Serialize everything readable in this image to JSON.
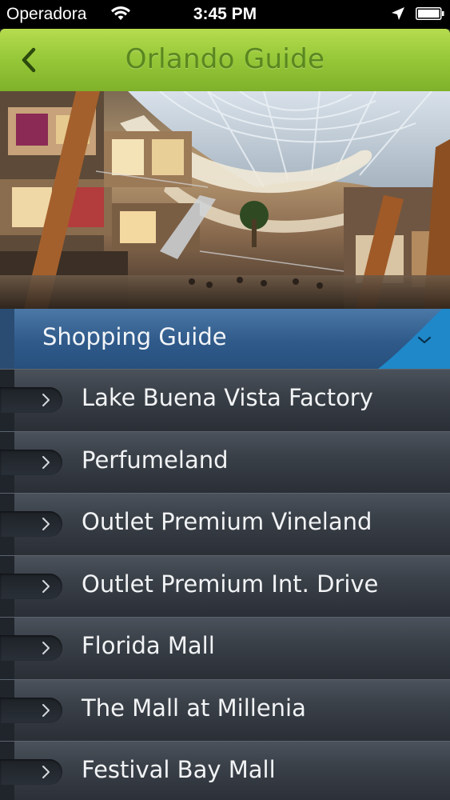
{
  "status_bar": {
    "carrier": "Operadora",
    "time": "3:45 PM",
    "icons": [
      "wifi-icon",
      "location-icon",
      "battery-icon"
    ]
  },
  "nav": {
    "title": "Orlando Guide",
    "back_icon": "chevron-left-icon"
  },
  "hero": {
    "image": "mall-interior-photo"
  },
  "section": {
    "title": "Shopping Guide",
    "dropdown_icon": "chevron-down-icon"
  },
  "list": {
    "items": [
      {
        "label": "Lake Buena Vista Factory"
      },
      {
        "label": "Perfumeland"
      },
      {
        "label": "Outlet Premium Vineland"
      },
      {
        "label": "Outlet Premium Int. Drive"
      },
      {
        "label": "Florida Mall"
      },
      {
        "label": "The Mall at Millenia"
      },
      {
        "label": "Festival Bay Mall"
      }
    ]
  },
  "colors": {
    "nav_green": "#98c93a",
    "nav_title": "#5a8720",
    "section_blue": "#2f5a8a",
    "list_bg": "#3a4048"
  }
}
